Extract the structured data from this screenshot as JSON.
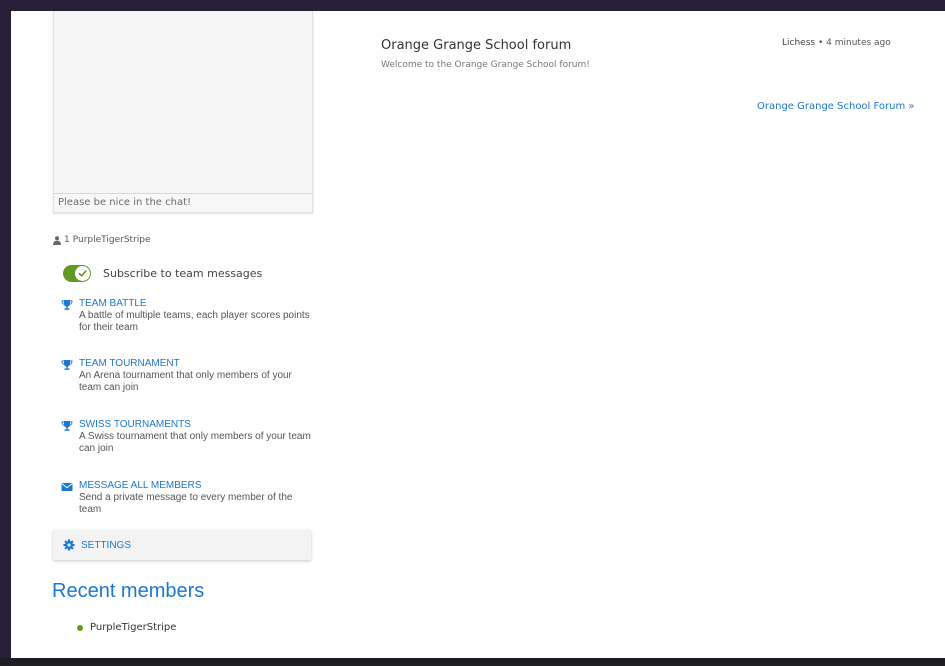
{
  "chat": {
    "input_placeholder": "Please be nice in the chat!"
  },
  "members": {
    "icon": "user-icon",
    "count": "1",
    "name": "PurpleTigerStripe"
  },
  "subscribe": {
    "label": "Subscribe to team messages",
    "enabled": true
  },
  "actions": [
    {
      "icon": "trophy-icon",
      "title": "TEAM BATTLE",
      "description": "A battle of multiple teams, each player scores points for their team"
    },
    {
      "icon": "trophy-icon",
      "title": "TEAM TOURNAMENT",
      "description": "An Arena tournament that only members of your team can join"
    },
    {
      "icon": "trophy-icon",
      "title": "SWISS TOURNAMENTS",
      "description": "A Swiss tournament that only members of your team can join"
    },
    {
      "icon": "envelope-icon",
      "title": "MESSAGE ALL MEMBERS",
      "description": "Send a private message to every member of the team"
    }
  ],
  "settings": {
    "icon": "gear-icon",
    "label": "SETTINGS"
  },
  "recent_members": {
    "title": "Recent members",
    "items": [
      {
        "name": "PurpleTigerStripe",
        "status": "online"
      }
    ]
  },
  "forum": {
    "title": "Orange Grange School forum",
    "description": "Welcome to the Orange Grange School forum!",
    "author": "Lichess",
    "separator": "•",
    "time": "4 minutes ago",
    "link_label": "Orange Grange School Forum »"
  },
  "colors": {
    "accent": "#1b78d0",
    "online": "#629924",
    "border_frame": "#2a1f38"
  }
}
